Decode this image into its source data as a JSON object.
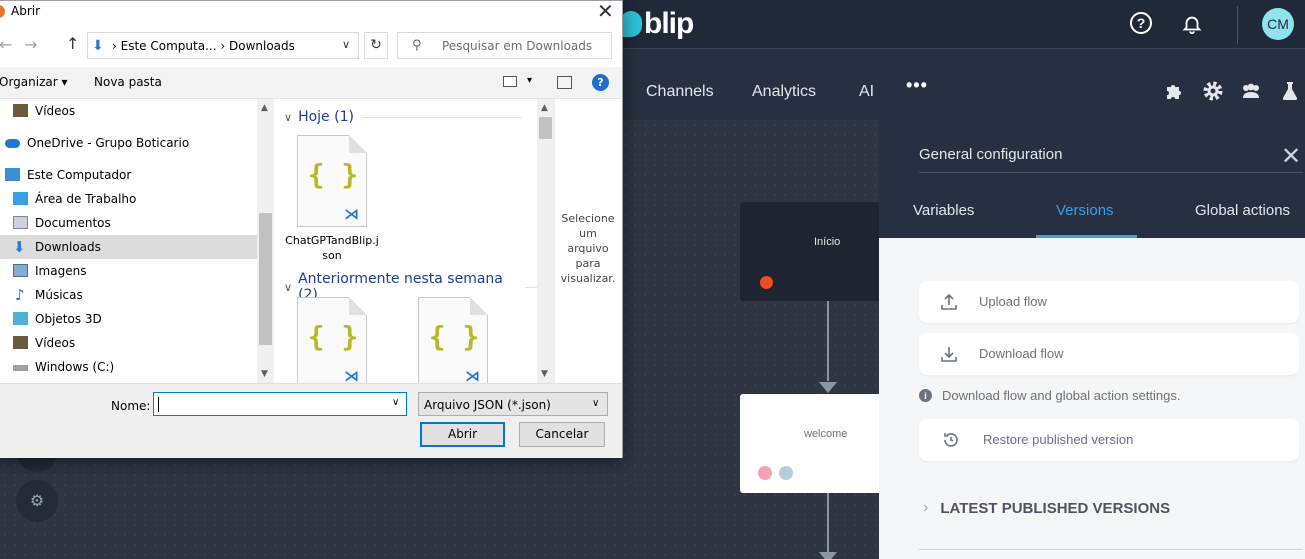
{
  "app": {
    "brand": "blip",
    "user_initials": "CM",
    "help_glyph": "?",
    "nav": [
      "Channels",
      "Analytics",
      "AI"
    ],
    "nav_more": "•••",
    "icons": [
      "puzzle-icon",
      "gear-icon",
      "team-icon",
      "flask-icon"
    ],
    "colors": {
      "accent": "#3d9ee9",
      "brand": "#2cc3d5",
      "start_dot": "#f04b23"
    }
  },
  "canvas": {
    "start_node": "Início",
    "welcome_node": "welcome"
  },
  "panel": {
    "title": "General configuration",
    "close_glyph": "✕",
    "tabs": [
      "Variables",
      "Versions",
      "Global actions"
    ],
    "active_tab": "Versions",
    "upload": "Upload flow",
    "download": "Download flow",
    "info": "Download flow and global action settings.",
    "restore": "Restore published version",
    "latest": "LATEST PUBLISHED VERSIONS",
    "chev": "›"
  },
  "dialog": {
    "title": "Abrir",
    "close_glyph": "✕",
    "back_glyph": "←",
    "forward_glyph": "→",
    "up_glyph": "↑",
    "address": [
      "Este Computa...",
      "Downloads"
    ],
    "address_sep": "›",
    "refresh_glyph": "↻",
    "search_placeholder": "Pesquisar em Downloads",
    "organize": "Organizar ▾",
    "new_folder": "Nova pasta",
    "tree": [
      {
        "label": "Vídeos",
        "icon": "video-folder-icon",
        "selected": false
      },
      {
        "label": "OneDrive - Grupo Boticario",
        "icon": "onedrive-icon",
        "selected": false
      },
      {
        "label": "Este Computador",
        "icon": "computer-icon",
        "selected": false
      },
      {
        "label": "Área de Trabalho",
        "icon": "desktop-icon",
        "selected": false
      },
      {
        "label": "Documentos",
        "icon": "documents-icon",
        "selected": false
      },
      {
        "label": "Downloads",
        "icon": "downloads-icon",
        "selected": true
      },
      {
        "label": "Imagens",
        "icon": "pictures-icon",
        "selected": false
      },
      {
        "label": "Músicas",
        "icon": "music-icon",
        "selected": false
      },
      {
        "label": "Objetos 3D",
        "icon": "3d-objects-icon",
        "selected": false
      },
      {
        "label": "Vídeos",
        "icon": "video-folder-icon",
        "selected": false
      },
      {
        "label": "Windows (C:)",
        "icon": "drive-icon",
        "selected": false
      }
    ],
    "groups": [
      {
        "title": "Hoje (1)",
        "files": [
          "ChatGPTandBlip.json"
        ]
      },
      {
        "title": "Anteriormente nesta semana (2)",
        "files": [
          "",
          ""
        ]
      }
    ],
    "file_braces": "{ }",
    "preview_text": "Selecione um arquivo para visualizar.",
    "name_label": "Nome:",
    "name_value": "",
    "file_type": "Arquivo JSON (*.json)",
    "open_button": "Abrir",
    "cancel_button": "Cancelar"
  }
}
